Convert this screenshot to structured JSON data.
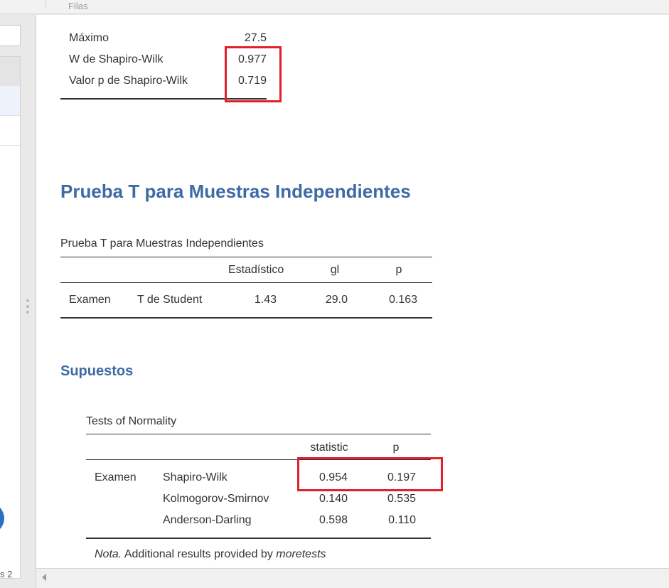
{
  "toolbar": {
    "rows_label": "Filas"
  },
  "left_panel": {
    "status_text": "s 2"
  },
  "descriptives_tail": {
    "rows": [
      {
        "label": "Máximo",
        "value": "27.5"
      },
      {
        "label": "W de Shapiro-Wilk",
        "value": "0.977"
      },
      {
        "label": "Valor p de Shapiro-Wilk",
        "value": "0.719"
      }
    ]
  },
  "ttest": {
    "heading": "Prueba T para Muestras Independientes",
    "table_title": "Prueba T para Muestras Independientes",
    "columns": [
      "Estadístico",
      "gl",
      "p"
    ],
    "row": {
      "variable": "Examen",
      "test": "T de Student",
      "statistic": "1.43",
      "df": "29.0",
      "p": "0.163"
    }
  },
  "assumptions": {
    "heading": "Supuestos",
    "table_title": "Tests of Normality",
    "columns": [
      "statistic",
      "p"
    ],
    "variable": "Examen",
    "rows": [
      {
        "test": "Shapiro-Wilk",
        "statistic": "0.954",
        "p": "0.197"
      },
      {
        "test": "Kolmogorov-Smirnov",
        "statistic": "0.140",
        "p": "0.535"
      },
      {
        "test": "Anderson-Darling",
        "statistic": "0.598",
        "p": "0.110"
      }
    ],
    "note_prefix": "Nota.",
    "note_text": " Additional results provided by ",
    "note_module": "moretests"
  },
  "colors": {
    "heading": "#3e6aa5",
    "highlight": "#e0202a"
  }
}
